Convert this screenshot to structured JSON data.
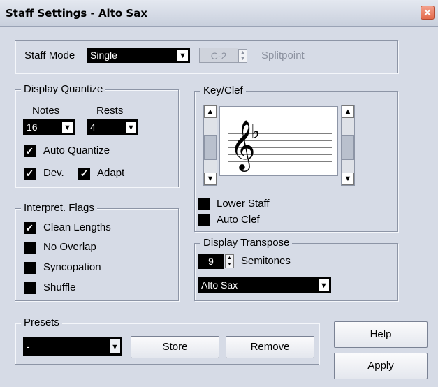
{
  "window": {
    "title": "Staff Settings - Alto Sax",
    "close_label": "✕"
  },
  "staff_mode": {
    "label": "Staff Mode",
    "value": "Single",
    "splitpoint_value": "C-2",
    "splitpoint_label": "Splitpoint"
  },
  "display_quantize": {
    "legend": "Display Quantize",
    "notes_label": "Notes",
    "notes_value": "16",
    "rests_label": "Rests",
    "rests_value": "4",
    "auto_quantize": {
      "label": "Auto Quantize",
      "checked": true
    },
    "dev": {
      "label": "Dev.",
      "checked": true
    },
    "adapt": {
      "label": "Adapt",
      "checked": true
    }
  },
  "key_clef": {
    "legend": "Key/Clef",
    "clef_icon": "treble-clef-icon",
    "key_icon": "flat-icon",
    "lower_staff": {
      "label": "Lower Staff",
      "checked": false
    },
    "auto_clef": {
      "label": "Auto Clef",
      "checked": false
    }
  },
  "interpret_flags": {
    "legend": "Interpret. Flags",
    "items": [
      {
        "label": "Clean Lengths",
        "checked": true
      },
      {
        "label": "No Overlap",
        "checked": false
      },
      {
        "label": "Syncopation",
        "checked": false
      },
      {
        "label": "Shuffle",
        "checked": false
      }
    ]
  },
  "display_transpose": {
    "legend": "Display Transpose",
    "semitones_value": "9",
    "semitones_label": "Semitones",
    "instrument": "Alto Sax"
  },
  "presets": {
    "legend": "Presets",
    "value": "-",
    "store_label": "Store",
    "remove_label": "Remove"
  },
  "buttons": {
    "help_label": "Help",
    "apply_label": "Apply"
  },
  "colors": {
    "background": "#d6dbe6",
    "field_bg": "#000000",
    "close_accent": "#e36a4c"
  }
}
